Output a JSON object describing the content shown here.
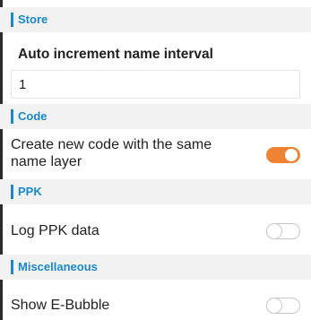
{
  "sections": {
    "store": {
      "title": "Store"
    },
    "code": {
      "title": "Code"
    },
    "ppk": {
      "title": "PPK"
    },
    "misc": {
      "title": "Miscellaneous"
    }
  },
  "store": {
    "auto_increment_label": "Auto increment name interval",
    "auto_increment_value": "1"
  },
  "code": {
    "create_new_code_label_line1": "Create new code with the same",
    "create_new_code_label_line2": "name layer",
    "create_new_code_enabled": true
  },
  "ppk": {
    "log_ppk_label": "Log PPK data",
    "log_ppk_enabled": false
  },
  "misc": {
    "show_ebubble_label": "Show E-Bubble",
    "show_ebubble_enabled": false
  },
  "colors": {
    "accent": "#1a88c9",
    "toggle_on": "#f08333",
    "toggle_off_border": "#c8c8c8",
    "header_bg": "#f2f2f2"
  }
}
